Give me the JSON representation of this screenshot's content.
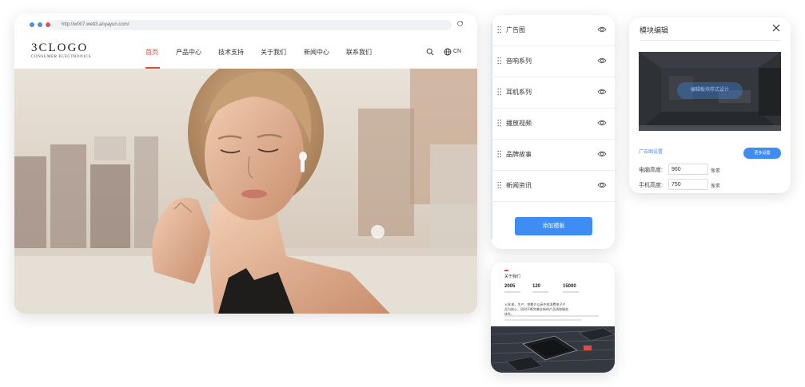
{
  "browser": {
    "url": "http://w007.web3.anyayun.com/",
    "dot_colors": [
      "#4a90e2",
      "#4a90e2",
      "#e8524a"
    ],
    "logo": {
      "main": "3CLOGO",
      "sub": "CONSUMER ELECTRONICS"
    },
    "nav": [
      {
        "label": "首页",
        "active": true
      },
      {
        "label": "产品中心",
        "active": false
      },
      {
        "label": "技术支持",
        "active": false
      },
      {
        "label": "关于我们",
        "active": false
      },
      {
        "label": "新闻中心",
        "active": false
      },
      {
        "label": "联系我们",
        "active": false
      }
    ],
    "lang": "CN",
    "accent": "#e54b3c"
  },
  "modules": {
    "items": [
      {
        "label": "广告图",
        "icon": "eye-icon"
      },
      {
        "label": "音响系列",
        "icon": "eye-icon"
      },
      {
        "label": "耳机系列",
        "icon": "eye-icon"
      },
      {
        "label": "播放视频",
        "icon": "eye-icon"
      },
      {
        "label": "品牌故事",
        "icon": "eye-icon"
      },
      {
        "label": "新闻资讯",
        "icon": "eye-icon"
      }
    ],
    "add_button": "添加模板",
    "accent": "#3d8df5"
  },
  "preview": {
    "title": "关于我们",
    "stats": [
      "2005",
      "120",
      "15000"
    ],
    "text": "10年来，生产、销售方以高中档消费电子产品为核心，同时不断完善全新的产品线和服务体系。"
  },
  "editor": {
    "title": "模块编辑",
    "thumb_badge": "编辑板块样式设计",
    "section_label": "广告图设置",
    "more_button": "更多设置",
    "fields": [
      {
        "label": "电脑高度:",
        "value": "960",
        "unit": "像素"
      },
      {
        "label": "手机高度:",
        "value": "750",
        "unit": "像素"
      }
    ]
  }
}
